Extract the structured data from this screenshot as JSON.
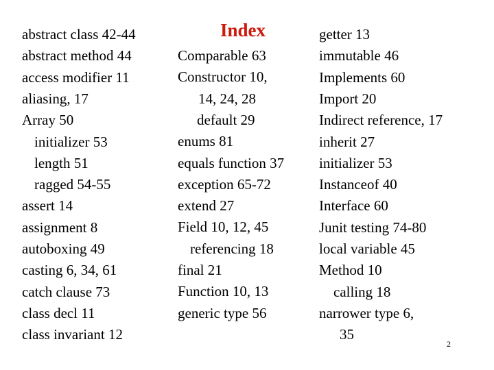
{
  "title": "Index",
  "page_number": "2",
  "columns": [
    [
      {
        "text": "abstract class  42-44",
        "indent": 0
      },
      {
        "text": "abstract method 44",
        "indent": 0
      },
      {
        "text": "access modifier 11",
        "indent": 0
      },
      {
        "text": "aliasing, 17",
        "indent": 0
      },
      {
        "text": "Array 50",
        "indent": 0
      },
      {
        "text": "initializer 53",
        "indent": 1
      },
      {
        "text": "length 51",
        "indent": 1
      },
      {
        "text": "ragged 54-55",
        "indent": 1
      },
      {
        "text": "assert 14",
        "indent": 0
      },
      {
        "text": "assignment  8",
        "indent": 0
      },
      {
        "text": "autoboxing 49",
        "indent": 0
      },
      {
        "text": "casting 6, 34, 61",
        "indent": 0
      },
      {
        "text": "catch clause 73",
        "indent": 0
      },
      {
        "text": "class decl 11",
        "indent": 0
      },
      {
        "text": "class invariant 12",
        "indent": 0
      }
    ],
    [
      {
        "text": "Comparable 63",
        "indent": 0
      },
      {
        "text": "Constructor 10,",
        "indent": 0
      },
      {
        "text": "14, 24, 28",
        "indent": 4
      },
      {
        "text": "default 29",
        "indent": 2
      },
      {
        "text": "enums 81",
        "indent": 0
      },
      {
        "text": "equals function 37",
        "indent": 0
      },
      {
        "text": "exception 65-72",
        "indent": 0
      },
      {
        "text": "extend 27",
        "indent": 0
      },
      {
        "text": "Field 10, 12, 45",
        "indent": 0
      },
      {
        "text": "referencing 18",
        "indent": 1
      },
      {
        "text": "final 21",
        "indent": 0
      },
      {
        "text": "Function 10, 13",
        "indent": 0
      },
      {
        "text": "generic type 56",
        "indent": 0
      }
    ],
    [
      {
        "text": "getter 13",
        "indent": 0
      },
      {
        "text": "immutable 46",
        "indent": 0
      },
      {
        "text": "Implements 60",
        "indent": 0
      },
      {
        "text": "Import 20",
        "indent": 0
      },
      {
        "text": "Indirect reference, 17",
        "indent": 0
      },
      {
        "text": "inherit 27",
        "indent": 0
      },
      {
        "text": "initializer 53",
        "indent": 0
      },
      {
        "text": "Instanceof 40",
        "indent": 0
      },
      {
        "text": "Interface 60",
        "indent": 0
      },
      {
        "text": "Junit testing 74-80",
        "indent": 0
      },
      {
        "text": "local variable 45",
        "indent": 0
      },
      {
        "text": "Method 10",
        "indent": 0
      },
      {
        "text": "calling 18",
        "indent": 3
      },
      {
        "text": "narrower type 6,",
        "indent": 0
      },
      {
        "text": "35",
        "indent": 4
      }
    ]
  ]
}
